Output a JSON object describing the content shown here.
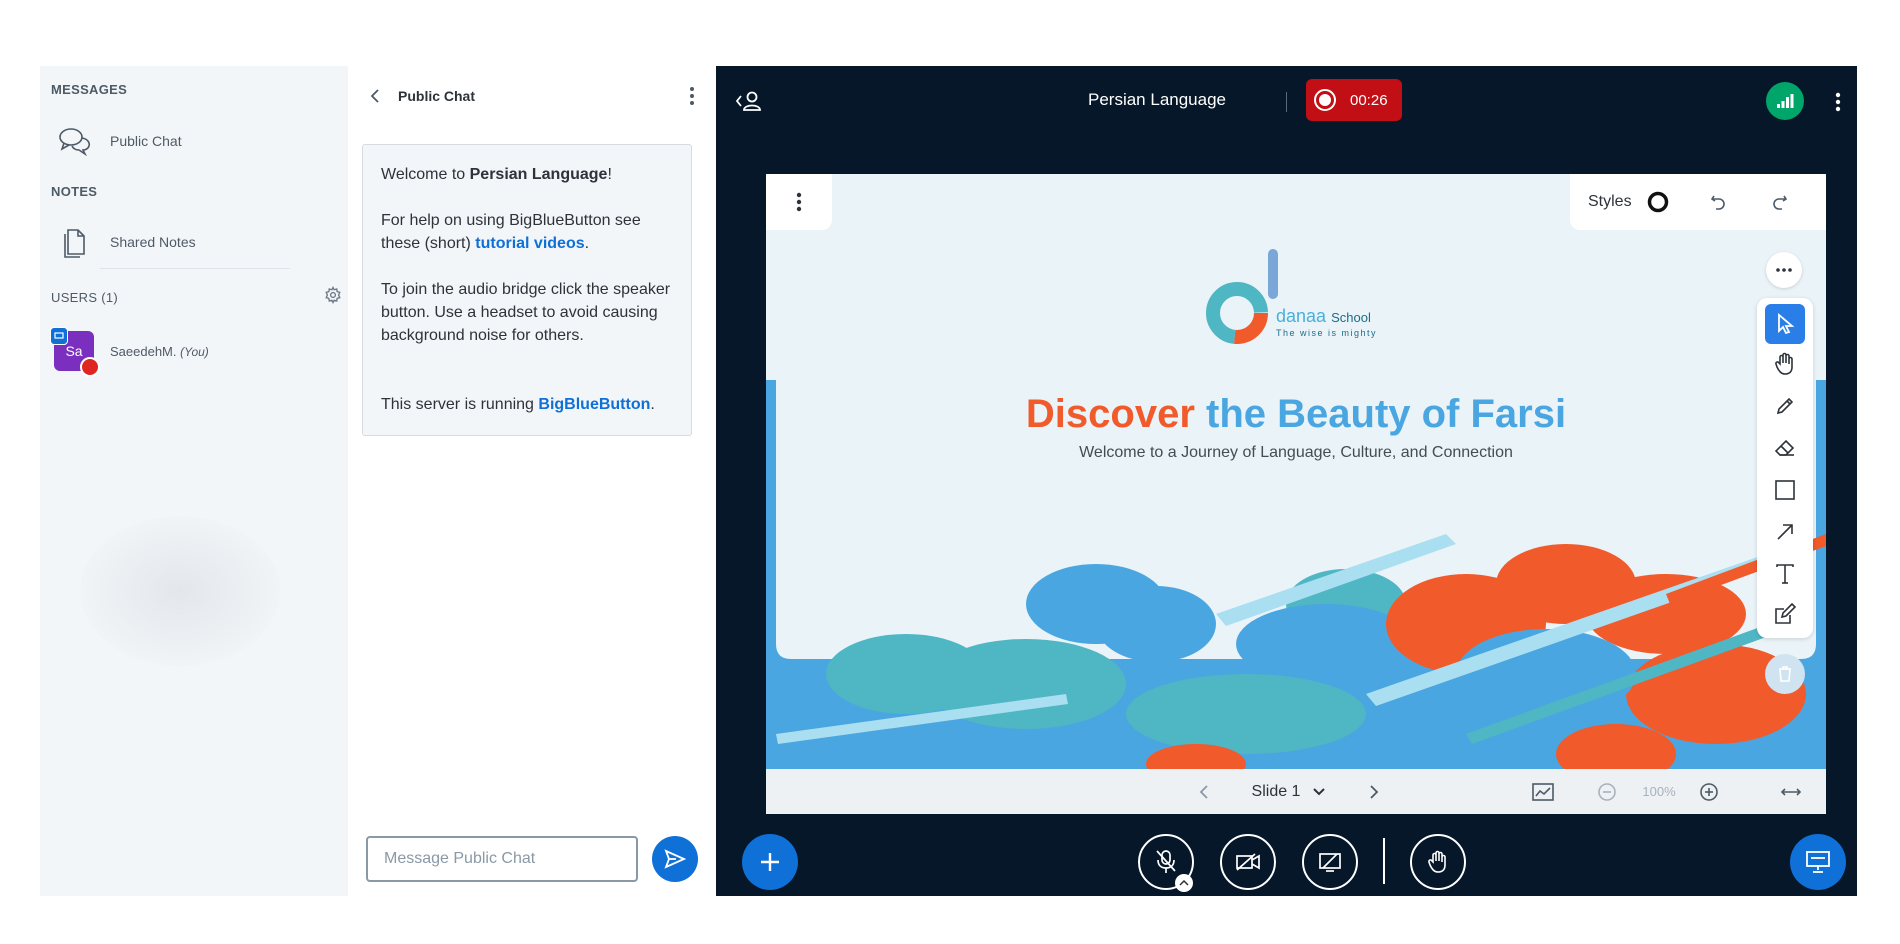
{
  "sidebar": {
    "messages_title": "MESSAGES",
    "public_chat_label": "Public Chat",
    "notes_title": "NOTES",
    "shared_notes_label": "Shared Notes",
    "users_title": "USERS (1)",
    "user": {
      "initials": "Sa",
      "name": "SaeedehM.",
      "you_tag": "(You)",
      "avatar_color": "#7b2fbe"
    }
  },
  "chat": {
    "header_title": "Public Chat",
    "welcome": {
      "line1_prefix": "Welcome to ",
      "line1_bold": "Persian Language",
      "line1_suffix": "!",
      "help_text": "For help on using BigBlueButton see these (short) ",
      "help_link": "tutorial videos",
      "help_end": ".",
      "audio_text": "To join the audio bridge click the speaker button. Use a headset to avoid causing background noise for others.",
      "server_text": "This server is running ",
      "server_link": "BigBlueButton",
      "server_end": "."
    },
    "input_placeholder": "Message Public Chat"
  },
  "header": {
    "meeting_title": "Persian Language",
    "recording_time": "00:26",
    "recording_color": "#c20e15",
    "connection_color": "#00a56a"
  },
  "presentation": {
    "styles_label": "Styles",
    "slide_title_part1": "Discover",
    "slide_title_part2": "the Beauty of Farsi",
    "slide_subtitle": "Welcome to a Journey of Language, Culture, and Connection",
    "logo_brand": "danaa",
    "logo_school": "School",
    "logo_tagline": "The wise is mighty",
    "slide_label": "Slide 1",
    "zoom": "100%",
    "accent_orange": "#f15a2b",
    "accent_blue": "#4aa6e0"
  },
  "icons": {
    "chat": "chat-bubbles-icon",
    "notes": "document-icon",
    "settings": "gear-icon",
    "mute": "microphone-off-icon",
    "camera": "camera-off-icon",
    "screenshare": "screenshare-off-icon",
    "raise_hand": "raise-hand-icon"
  }
}
